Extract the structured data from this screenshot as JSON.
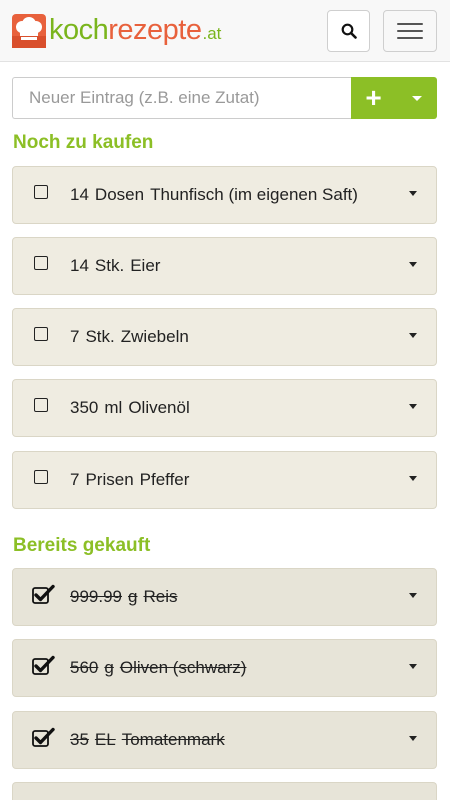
{
  "header": {
    "logo": {
      "part1": "koch",
      "part2": "rezepte",
      "part3": ".at"
    },
    "search_icon": "search-icon",
    "menu_icon": "hamburger-menu-icon"
  },
  "entry": {
    "placeholder": "Neuer Eintrag (z.B. eine Zutat)",
    "add_icon": "plus-icon",
    "dropdown_icon": "caret-down-icon"
  },
  "colors": {
    "accent_green": "#8cbf26",
    "logo_orange": "#e8613c",
    "item_background": "#efece1"
  },
  "to_buy": {
    "title": "Noch zu kaufen",
    "items": [
      {
        "qty": "14",
        "unit": "Dosen",
        "name": "Thunfisch (im eigenen Saft)",
        "checked": false
      },
      {
        "qty": "14",
        "unit": "Stk.",
        "name": "Eier",
        "checked": false
      },
      {
        "qty": "7",
        "unit": "Stk.",
        "name": "Zwiebeln",
        "checked": false
      },
      {
        "qty": "350",
        "unit": "ml",
        "name": "Olivenöl",
        "checked": false
      },
      {
        "qty": "7",
        "unit": "Prisen",
        "name": "Pfeffer",
        "checked": false
      }
    ]
  },
  "bought": {
    "title": "Bereits gekauft",
    "items": [
      {
        "qty": "999.99",
        "unit": "g",
        "name": "Reis",
        "checked": true
      },
      {
        "qty": "560",
        "unit": "g",
        "name": "Oliven (schwarz)",
        "checked": true
      },
      {
        "qty": "35",
        "unit": "EL",
        "name": "Tomatenmark",
        "checked": true
      }
    ]
  }
}
